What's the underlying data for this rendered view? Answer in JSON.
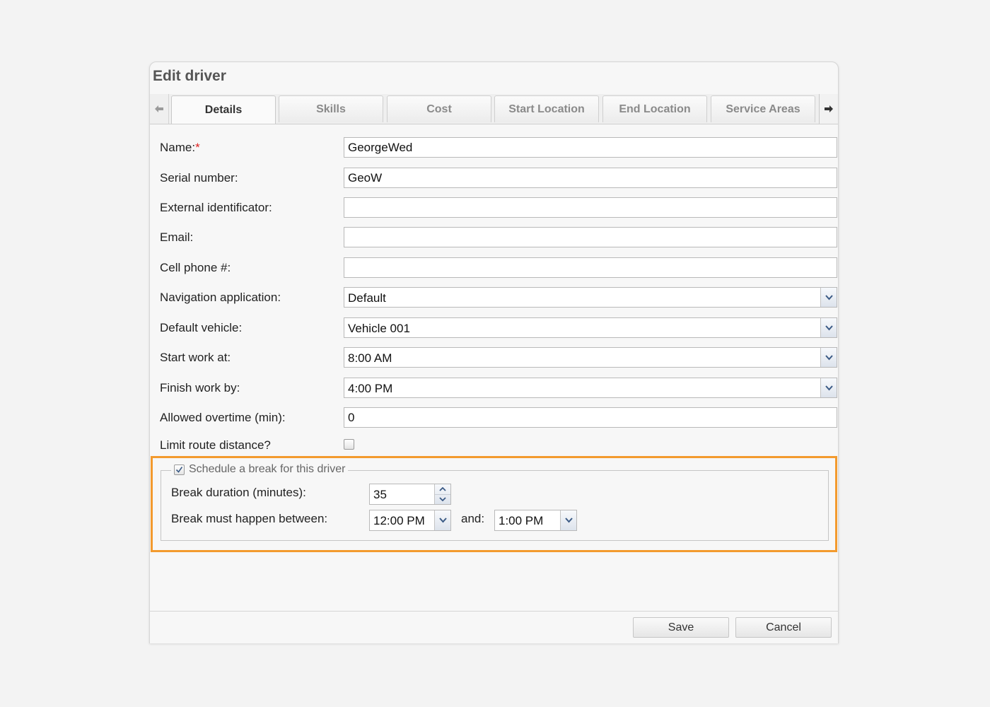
{
  "dialog": {
    "title": "Edit driver"
  },
  "tabs": [
    {
      "label": "Details",
      "active": true
    },
    {
      "label": "Skills"
    },
    {
      "label": "Cost"
    },
    {
      "label": "Start Location"
    },
    {
      "label": "End Location"
    },
    {
      "label": "Service Areas"
    }
  ],
  "tab_scroll": {
    "left_icon": "arrow-left",
    "right_icon": "arrow-right"
  },
  "form": {
    "name": {
      "label": "Name:",
      "required_mark": "*",
      "value": "GeorgeWed"
    },
    "serial": {
      "label": "Serial number:",
      "value": "GeoW"
    },
    "external_id": {
      "label": "External identificator:",
      "value": ""
    },
    "email": {
      "label": "Email:",
      "value": ""
    },
    "cell_phone": {
      "label": "Cell phone #:",
      "value": ""
    },
    "nav_app": {
      "label": "Navigation application:",
      "value": "Default"
    },
    "default_vehicle": {
      "label": "Default vehicle:",
      "value": "Vehicle 001"
    },
    "start_work": {
      "label": "Start work at:",
      "value": "8:00 AM"
    },
    "finish_work": {
      "label": "Finish work by:",
      "value": "4:00 PM"
    },
    "overtime": {
      "label": "Allowed overtime (min):",
      "value": "0"
    },
    "limit_route": {
      "label": "Limit route distance?",
      "checked": false
    }
  },
  "break": {
    "legend": "Schedule a break for this driver",
    "checked": true,
    "duration_label": "Break duration (minutes):",
    "duration_value": "35",
    "between_label": "Break must happen between:",
    "from_value": "12:00 PM",
    "and_label": "and:",
    "to_value": "1:00 PM",
    "highlight_color": "#f39a2e"
  },
  "footer": {
    "save_label": "Save",
    "cancel_label": "Cancel"
  }
}
